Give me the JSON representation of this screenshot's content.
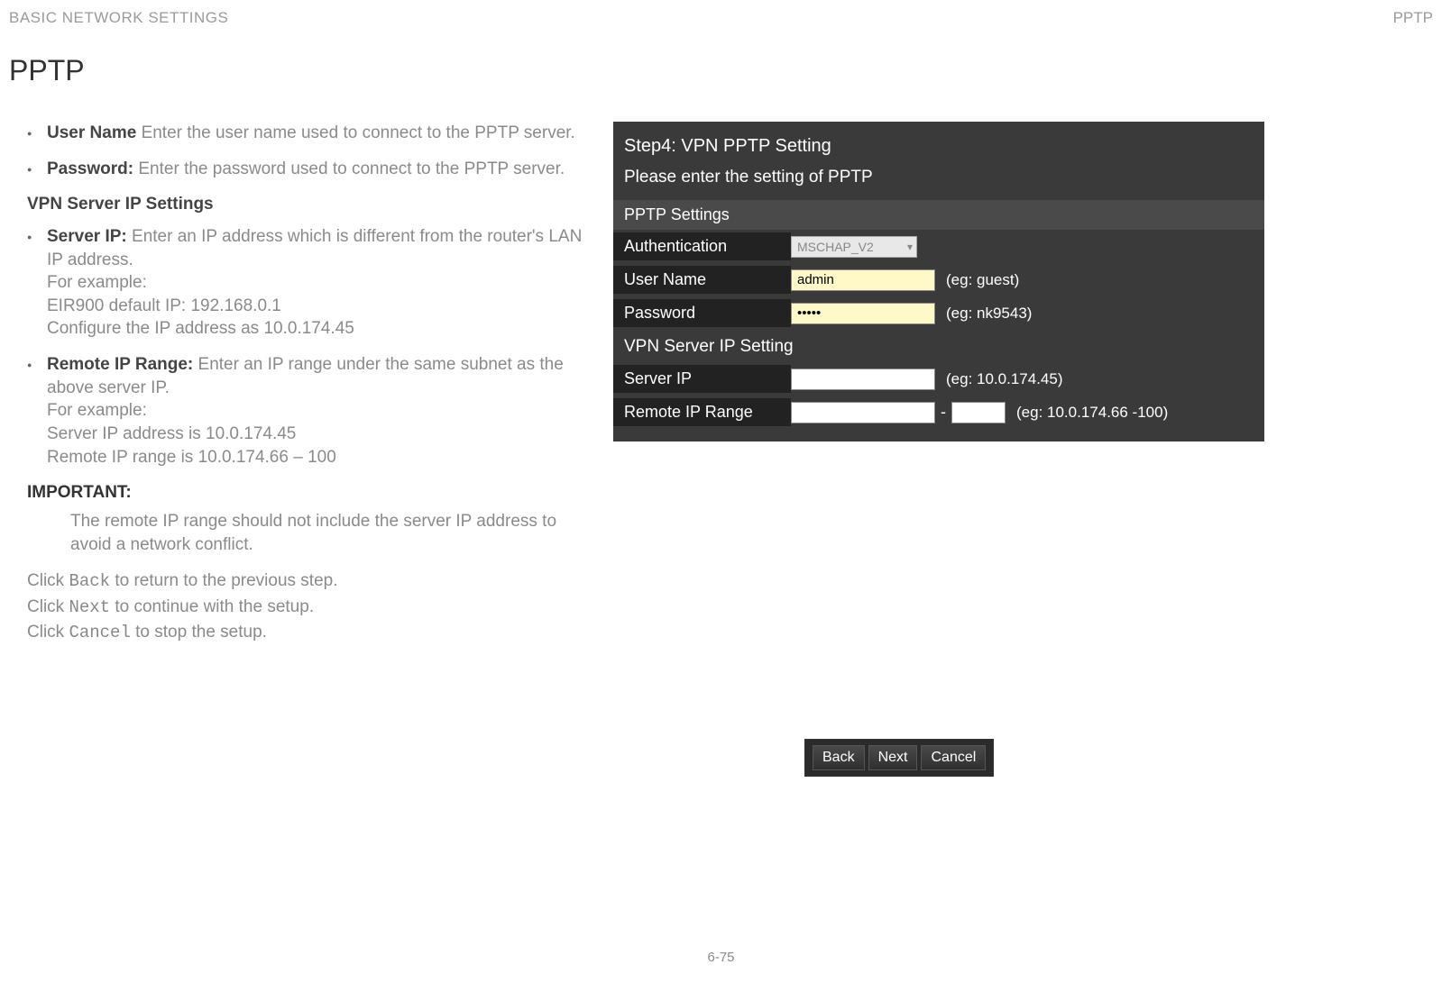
{
  "header": {
    "left": "BASIC NETWORK SETTINGS",
    "right": "PPTP"
  },
  "title": "PPTP",
  "bullets1": [
    {
      "label": "User Name",
      "sep": " ",
      "text": "Enter the user name used to connect to the PPTP server."
    },
    {
      "label": "Password:",
      "sep": " ",
      "text": "Enter the password used to connect to the PPTP server."
    }
  ],
  "subheading": "VPN Server IP Settings",
  "bullets2": [
    {
      "label": "Server IP:",
      "text": "Enter an IP address which is different from the router's LAN IP address.",
      "extra": [
        "For example:",
        "EIR900 default IP: 192.168.0.1",
        "Configure the IP address as 10.0.174.45"
      ]
    },
    {
      "label": "Remote IP Range:",
      "text": "Enter an IP range under the same subnet as the above server IP.",
      "extra": [
        "For example:",
        "Server IP address is 10.0.174.45",
        "Remote IP range is 10.0.174.66 – 100"
      ]
    }
  ],
  "important": {
    "label": "IMPORTANT:",
    "text": "The remote IP range should not include the server IP address to avoid a network conflict."
  },
  "footer_actions": {
    "line1_a": "Click ",
    "line1_code": "Back",
    "line1_b": " to return to the previous step.",
    "line2_a": "Click ",
    "line2_code": "Next",
    "line2_b": " to continue with the setup.",
    "line3_a": "Click ",
    "line3_code": "Cancel",
    "line3_b": " to stop the setup."
  },
  "page_num": "6-75",
  "shot": {
    "step_title": "Step4: VPN PPTP Setting",
    "prompt": "Please enter the setting of PPTP",
    "section1": "PPTP Settings",
    "rows1": {
      "auth_label": "Authentication",
      "auth_value": "MSCHAP_V2",
      "user_label": "User Name",
      "user_value": "admin",
      "user_hint": "(eg: guest)",
      "pass_label": "Password",
      "pass_value": "•••••",
      "pass_hint": "(eg: nk9543)"
    },
    "section2": "VPN Server IP Setting",
    "rows2": {
      "sip_label": "Server IP",
      "sip_value": "",
      "sip_hint": "(eg: 10.0.174.45)",
      "range_label": "Remote IP Range",
      "range_a": "",
      "range_sep": "-",
      "range_b": "",
      "range_hint": "(eg: 10.0.174.66 -100)"
    }
  },
  "buttons": {
    "back": "Back",
    "next": "Next",
    "cancel": "Cancel"
  }
}
